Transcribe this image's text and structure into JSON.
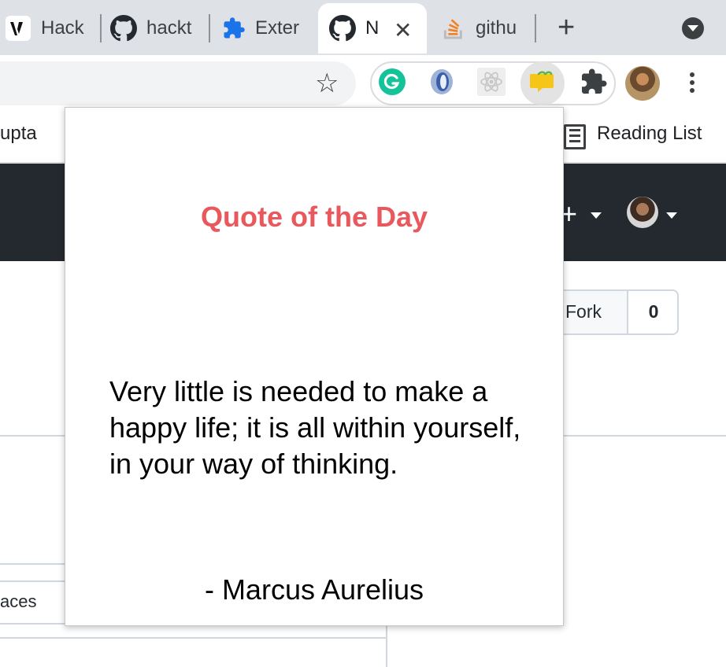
{
  "tabs": [
    {
      "label": "Hack",
      "icon": "v-logo-icon"
    },
    {
      "label": "hackt",
      "icon": "github-icon"
    },
    {
      "label": "Exter",
      "icon": "puzzle-icon"
    },
    {
      "label": "N",
      "icon": "github-icon",
      "active": true
    },
    {
      "label": "githu",
      "icon": "stackoverflow-icon"
    }
  ],
  "toolbar": {
    "extensions": [
      "grammarly-icon",
      "ring-extension-icon",
      "react-devtools-icon",
      "quote-extension-icon",
      "extensions-puzzle-icon"
    ]
  },
  "bookmarks": {
    "left_partial": "upta",
    "reading_list": "Reading List"
  },
  "github": {
    "fork_label": "Fork",
    "fork_count": "0",
    "spaces_partial": "aces"
  },
  "popup": {
    "title": "Quote of the Day",
    "quote": "Very little is needed to make a happy life; it is all within yourself, in your way of thinking.",
    "author": "- Marcus Aurelius"
  },
  "colors": {
    "title_red": "#e8585c",
    "github_dark": "#24292f",
    "tabstrip": "#dee1e6"
  }
}
